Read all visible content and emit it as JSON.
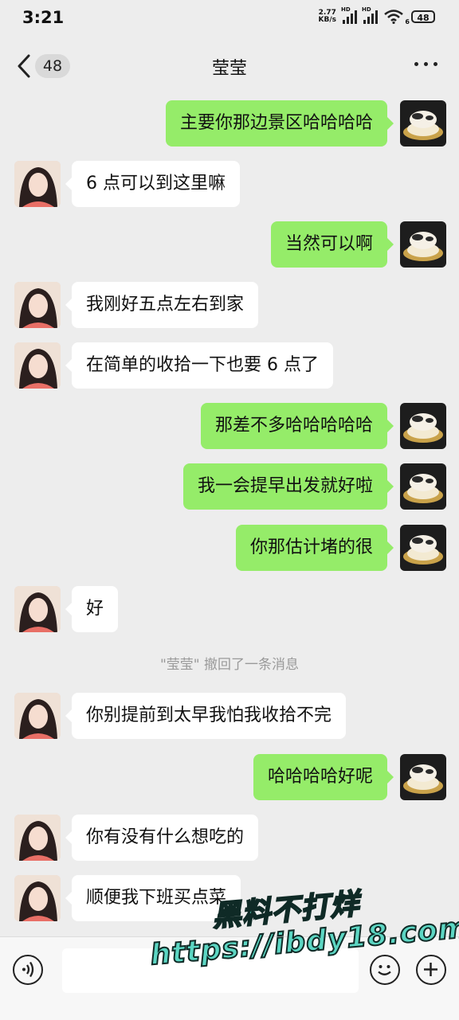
{
  "status_bar": {
    "time": "3:21",
    "net_speed": "2.77",
    "net_unit": "KB/s",
    "signal_label": "HD",
    "wifi_label": "6",
    "battery": "48"
  },
  "header": {
    "back_count": "48",
    "title": "莹莹"
  },
  "messages": [
    {
      "side": "out",
      "text": "主要你那边景区哈哈哈哈"
    },
    {
      "side": "in",
      "text": "6 点可以到这里嘛"
    },
    {
      "side": "out",
      "text": "当然可以啊"
    },
    {
      "side": "in",
      "text": "我刚好五点左右到家"
    },
    {
      "side": "in",
      "text": "在简单的收拾一下也要 6 点了"
    },
    {
      "side": "out",
      "text": "那差不多哈哈哈哈哈"
    },
    {
      "side": "out",
      "text": "我一会提早出发就好啦"
    },
    {
      "side": "out",
      "text": "你那估计堵的很"
    },
    {
      "side": "in",
      "text": "好"
    },
    {
      "side": "system",
      "text": "\"莹莹\" 撤回了一条消息"
    },
    {
      "side": "in",
      "text": "你别提前到太早我怕我收拾不完"
    },
    {
      "side": "out",
      "text": "哈哈哈哈好呢"
    },
    {
      "side": "in",
      "text": "你有没有什么想吃的"
    },
    {
      "side": "in",
      "text": "顺便我下班买点菜"
    }
  ],
  "watermark": {
    "line1": "黑料不打烊",
    "line2": "https://ibdy18.com"
  },
  "colors": {
    "background": "#ededed",
    "outgoing_bubble": "#95ec69",
    "incoming_bubble": "#ffffff",
    "watermark": "#5cd6c3"
  },
  "icons": {
    "back": "chevron-left-icon",
    "more": "more-dots-icon",
    "voice": "voice-icon",
    "emoji": "emoji-icon",
    "add": "add-icon"
  }
}
